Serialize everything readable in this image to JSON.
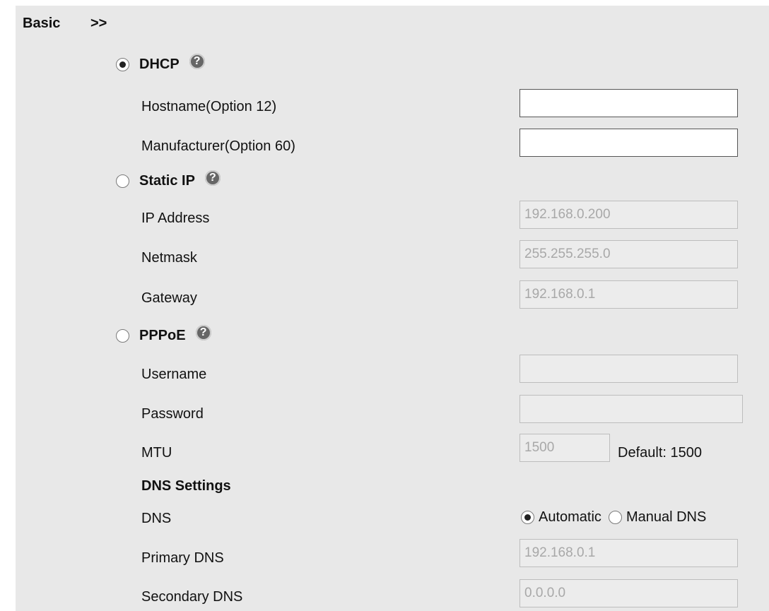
{
  "header": {
    "title": "Basic",
    "arrow": ">>"
  },
  "dhcp": {
    "label": "DHCP",
    "selected": true,
    "help_icon": "question-circle-icon",
    "hostname_label": "Hostname(Option 12)",
    "hostname_value": "",
    "manufacturer_label": "Manufacturer(Option 60)",
    "manufacturer_value": ""
  },
  "static_ip": {
    "label": "Static IP",
    "selected": false,
    "help_icon": "question-circle-icon",
    "ip_label": "IP Address",
    "ip_value": "192.168.0.200",
    "netmask_label": "Netmask",
    "netmask_value": "255.255.255.0",
    "gateway_label": "Gateway",
    "gateway_value": "192.168.0.1"
  },
  "pppoe": {
    "label": "PPPoE",
    "selected": false,
    "help_icon": "question-circle-icon",
    "username_label": "Username",
    "username_value": "",
    "password_label": "Password",
    "password_value": "",
    "mtu_label": "MTU",
    "mtu_value": "1500",
    "mtu_default": "Default: 1500"
  },
  "dns_settings": {
    "heading": "DNS Settings",
    "dns_label": "DNS",
    "automatic_label": "Automatic",
    "manual_label": "Manual DNS",
    "selected": "Automatic",
    "primary_label": "Primary DNS",
    "primary_value": "192.168.0.1",
    "secondary_label": "Secondary DNS",
    "secondary_value": "0.0.0.0"
  },
  "colors": {
    "panel_background": "#e8e8e8",
    "disabled_text": "#a8a8a8",
    "help_icon": "#666666"
  }
}
